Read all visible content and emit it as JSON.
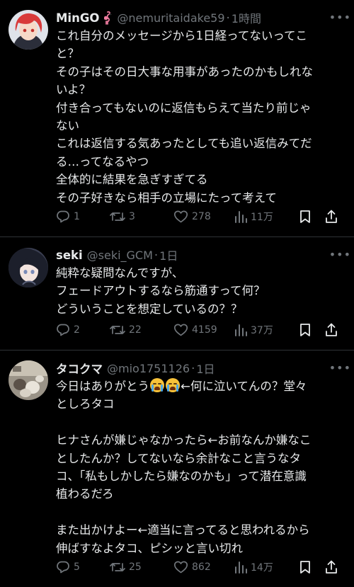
{
  "tweets": [
    {
      "name": "MinGO",
      "handle": "@nemuritaidake59",
      "separator": "·",
      "time": "1時間",
      "lines": [
        "これ自分のメッセージから1日経ってないってこ",
        "と？",
        "その子はその日大事な用事があったのかもしれな",
        "いよ？",
        "付き合ってもないのに返信もらえて当たり前じゃ",
        "ない",
        "これは返信する気あったとしても追い返信みてだ",
        "る…ってなるやつ",
        "全体的に結果を急ぎすぎてる",
        "その子好きなら相手の立場にたって考えて"
      ],
      "stats": {
        "replies": "1",
        "retweets": "3",
        "likes": "278",
        "views": "11万"
      }
    },
    {
      "name": "seki",
      "handle": "@seki_GCM",
      "separator": "·",
      "time": "1日",
      "lines": [
        "純粋な疑問なんですが、",
        "フェードアウトするなら筋通すって何？",
        "どういうことを想定しているの？？"
      ],
      "stats": {
        "replies": "2",
        "retweets": "22",
        "likes": "4159",
        "views": "37万"
      }
    },
    {
      "name": "タコクマ",
      "handle": "@mio1751126",
      "separator": "·",
      "time": "1日",
      "line1_before": "今日はありがとう",
      "line1_after": "←何に泣いてんの？堂々",
      "lines": [
        "としろタコ",
        "",
        "ヒナさんが嫌じゃなかったら←お前なんか嫌なこ",
        "としたんか？してないなら余計なこと言うなタ",
        "コ、「私もしかしたら嫌なのかも」って潜在意識",
        "植わるだろ",
        "",
        "また出かけよー←適当に言ってると思われるから",
        "伸ばすなよタコ、ピシッと言い切れ"
      ],
      "stats": {
        "replies": "5",
        "retweets": "25",
        "likes": "862",
        "views": "14万"
      }
    }
  ],
  "icons": {
    "more": "more-dots-icon",
    "reply": "reply-bubble-icon",
    "retweet": "retweet-icon",
    "like": "heart-icon",
    "views": "views-bar-chart-icon",
    "bookmark": "bookmark-icon",
    "share": "share-upload-icon",
    "emoji": "loudly-crying-face-emoji",
    "flamingo": "flamingo-emoji"
  },
  "colors": {
    "background": "#000000",
    "text": "#e7e9ea",
    "muted": "#71767b",
    "divider": "#2f3336"
  }
}
